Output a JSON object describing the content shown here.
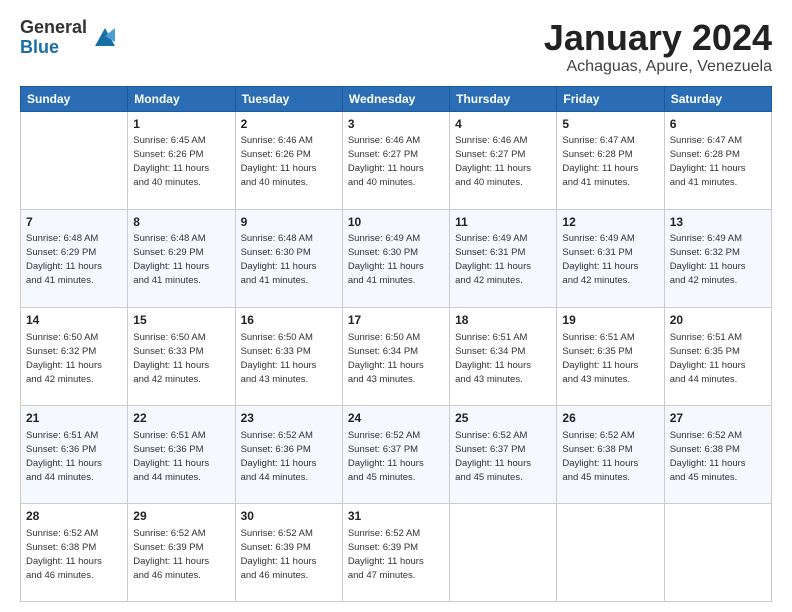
{
  "logo": {
    "general": "General",
    "blue": "Blue"
  },
  "header": {
    "month": "January 2024",
    "location": "Achaguas, Apure, Venezuela"
  },
  "days_of_week": [
    "Sunday",
    "Monday",
    "Tuesday",
    "Wednesday",
    "Thursday",
    "Friday",
    "Saturday"
  ],
  "weeks": [
    [
      {
        "day": "",
        "info": ""
      },
      {
        "day": "1",
        "info": "Sunrise: 6:45 AM\nSunset: 6:26 PM\nDaylight: 11 hours\nand 40 minutes."
      },
      {
        "day": "2",
        "info": "Sunrise: 6:46 AM\nSunset: 6:26 PM\nDaylight: 11 hours\nand 40 minutes."
      },
      {
        "day": "3",
        "info": "Sunrise: 6:46 AM\nSunset: 6:27 PM\nDaylight: 11 hours\nand 40 minutes."
      },
      {
        "day": "4",
        "info": "Sunrise: 6:46 AM\nSunset: 6:27 PM\nDaylight: 11 hours\nand 40 minutes."
      },
      {
        "day": "5",
        "info": "Sunrise: 6:47 AM\nSunset: 6:28 PM\nDaylight: 11 hours\nand 41 minutes."
      },
      {
        "day": "6",
        "info": "Sunrise: 6:47 AM\nSunset: 6:28 PM\nDaylight: 11 hours\nand 41 minutes."
      }
    ],
    [
      {
        "day": "7",
        "info": "Sunrise: 6:48 AM\nSunset: 6:29 PM\nDaylight: 11 hours\nand 41 minutes."
      },
      {
        "day": "8",
        "info": "Sunrise: 6:48 AM\nSunset: 6:29 PM\nDaylight: 11 hours\nand 41 minutes."
      },
      {
        "day": "9",
        "info": "Sunrise: 6:48 AM\nSunset: 6:30 PM\nDaylight: 11 hours\nand 41 minutes."
      },
      {
        "day": "10",
        "info": "Sunrise: 6:49 AM\nSunset: 6:30 PM\nDaylight: 11 hours\nand 41 minutes."
      },
      {
        "day": "11",
        "info": "Sunrise: 6:49 AM\nSunset: 6:31 PM\nDaylight: 11 hours\nand 42 minutes."
      },
      {
        "day": "12",
        "info": "Sunrise: 6:49 AM\nSunset: 6:31 PM\nDaylight: 11 hours\nand 42 minutes."
      },
      {
        "day": "13",
        "info": "Sunrise: 6:49 AM\nSunset: 6:32 PM\nDaylight: 11 hours\nand 42 minutes."
      }
    ],
    [
      {
        "day": "14",
        "info": "Sunrise: 6:50 AM\nSunset: 6:32 PM\nDaylight: 11 hours\nand 42 minutes."
      },
      {
        "day": "15",
        "info": "Sunrise: 6:50 AM\nSunset: 6:33 PM\nDaylight: 11 hours\nand 42 minutes."
      },
      {
        "day": "16",
        "info": "Sunrise: 6:50 AM\nSunset: 6:33 PM\nDaylight: 11 hours\nand 43 minutes."
      },
      {
        "day": "17",
        "info": "Sunrise: 6:50 AM\nSunset: 6:34 PM\nDaylight: 11 hours\nand 43 minutes."
      },
      {
        "day": "18",
        "info": "Sunrise: 6:51 AM\nSunset: 6:34 PM\nDaylight: 11 hours\nand 43 minutes."
      },
      {
        "day": "19",
        "info": "Sunrise: 6:51 AM\nSunset: 6:35 PM\nDaylight: 11 hours\nand 43 minutes."
      },
      {
        "day": "20",
        "info": "Sunrise: 6:51 AM\nSunset: 6:35 PM\nDaylight: 11 hours\nand 44 minutes."
      }
    ],
    [
      {
        "day": "21",
        "info": "Sunrise: 6:51 AM\nSunset: 6:36 PM\nDaylight: 11 hours\nand 44 minutes."
      },
      {
        "day": "22",
        "info": "Sunrise: 6:51 AM\nSunset: 6:36 PM\nDaylight: 11 hours\nand 44 minutes."
      },
      {
        "day": "23",
        "info": "Sunrise: 6:52 AM\nSunset: 6:36 PM\nDaylight: 11 hours\nand 44 minutes."
      },
      {
        "day": "24",
        "info": "Sunrise: 6:52 AM\nSunset: 6:37 PM\nDaylight: 11 hours\nand 45 minutes."
      },
      {
        "day": "25",
        "info": "Sunrise: 6:52 AM\nSunset: 6:37 PM\nDaylight: 11 hours\nand 45 minutes."
      },
      {
        "day": "26",
        "info": "Sunrise: 6:52 AM\nSunset: 6:38 PM\nDaylight: 11 hours\nand 45 minutes."
      },
      {
        "day": "27",
        "info": "Sunrise: 6:52 AM\nSunset: 6:38 PM\nDaylight: 11 hours\nand 45 minutes."
      }
    ],
    [
      {
        "day": "28",
        "info": "Sunrise: 6:52 AM\nSunset: 6:38 PM\nDaylight: 11 hours\nand 46 minutes."
      },
      {
        "day": "29",
        "info": "Sunrise: 6:52 AM\nSunset: 6:39 PM\nDaylight: 11 hours\nand 46 minutes."
      },
      {
        "day": "30",
        "info": "Sunrise: 6:52 AM\nSunset: 6:39 PM\nDaylight: 11 hours\nand 46 minutes."
      },
      {
        "day": "31",
        "info": "Sunrise: 6:52 AM\nSunset: 6:39 PM\nDaylight: 11 hours\nand 47 minutes."
      },
      {
        "day": "",
        "info": ""
      },
      {
        "day": "",
        "info": ""
      },
      {
        "day": "",
        "info": ""
      }
    ]
  ]
}
